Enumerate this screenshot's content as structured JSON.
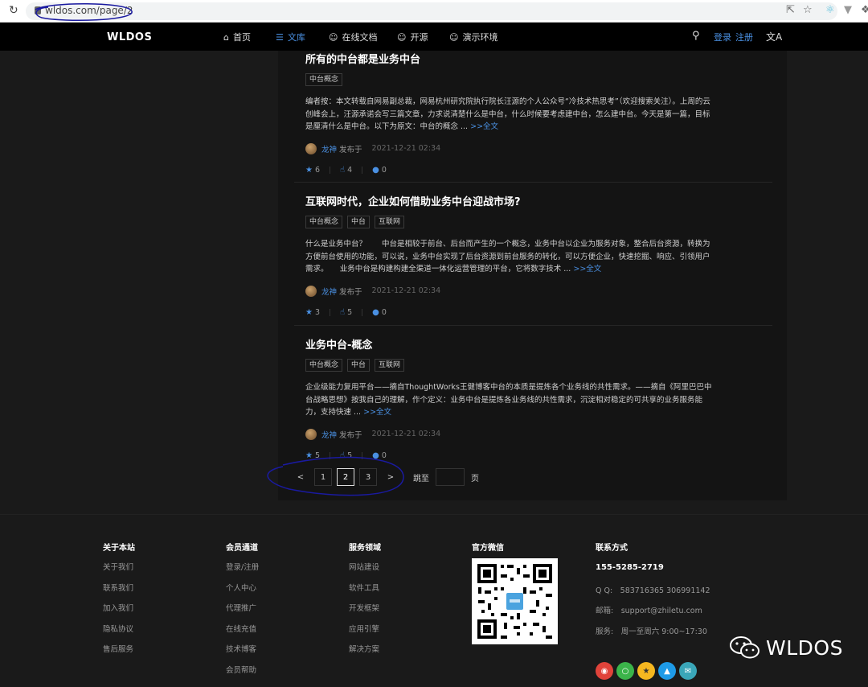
{
  "browser": {
    "url": "wldos.com/page/2",
    "reload_icon": "reload-icon",
    "ext_icons": [
      "share-icon",
      "star-icon",
      "react-icon",
      "vue-icon",
      "puzzle-icon"
    ]
  },
  "nav": {
    "logo": "WLDOS",
    "items": [
      {
        "label": "首页",
        "icon": "home-icon",
        "active": false
      },
      {
        "label": "文库",
        "icon": "list-icon",
        "active": true
      },
      {
        "label": "在线文档",
        "icon": "smile-icon",
        "active": false
      },
      {
        "label": "开源",
        "icon": "smile-icon",
        "active": false
      },
      {
        "label": "演示环境",
        "icon": "smile-icon",
        "active": false
      }
    ],
    "login": "登录",
    "register": "注册"
  },
  "articles": [
    {
      "title": "所有的中台都是业务中台",
      "tags": [
        "中台概念"
      ],
      "excerpt": "编者按：本文转载自网易副总裁，网易杭州研究院执行院长汪源的个人公众号“冷技术热思考”（欢迎搜索关注）。上周的云创峰会上，汪源承诺会写三篇文章，力求说清楚什么是中台，什么时候要考虑建中台，怎么建中台。今天是第一篇，目标是厘清什么是中台。以下为原文：中台的概念 ... ",
      "more": ">>全文",
      "author": "龙神",
      "posted": "发布于",
      "date": "2021-12-21 02:34",
      "stars": "6",
      "likes": "4",
      "comments": "0"
    },
    {
      "title": "互联网时代，企业如何借助业务中台迎战市场?",
      "tags": [
        "中台概念",
        "中台",
        "互联网"
      ],
      "excerpt": "什么是业务中台？　　中台是相较于前台、后台而产生的一个概念，业务中台以企业为服务对象，整合后台资源，转换为方便前台使用的功能，可以说，业务中台实现了后台资源到前台服务的转化，可以方便企业，快速挖掘、响应、引领用户需求。　　业务中台是构建构建全渠道一体化运营管理的平台，它将数字技术 ... ",
      "more": ">>全文",
      "author": "龙神",
      "posted": "发布于",
      "date": "2021-12-21 02:34",
      "stars": "3",
      "likes": "5",
      "comments": "0"
    },
    {
      "title": "业务中台-概念",
      "tags": [
        "中台概念",
        "中台",
        "互联网"
      ],
      "excerpt": "企业级能力复用平台——摘自ThoughtWorks王健博客中台的本质是提炼各个业务线的共性需求。——摘自《阿里巴巴中台战略思想》按我自己的理解，作个定义：业务中台是提炼各业务线的共性需求，沉淀相对稳定的可共享的业务服务能力，支持快速 ... ",
      "more": ">>全文",
      "author": "龙神",
      "posted": "发布于",
      "date": "2021-12-21 02:34",
      "stars": "5",
      "likes": "5",
      "comments": "0"
    }
  ],
  "pagination": {
    "prev": "<",
    "pages": [
      "1",
      "2",
      "3"
    ],
    "current": 2,
    "next": ">",
    "jump_label": "跳至",
    "jump_suffix": "页"
  },
  "footer": {
    "about": {
      "title": "关于本站",
      "links": [
        "关于我们",
        "联系我们",
        "加入我们",
        "隐私协议",
        "售后服务"
      ]
    },
    "member": {
      "title": "会员通道",
      "links": [
        "登录/注册",
        "个人中心",
        "代理推广",
        "在线充值",
        "技术博客",
        "会员帮助"
      ]
    },
    "service": {
      "title": "服务领域",
      "links": [
        "网站建设",
        "软件工具",
        "开发框架",
        "应用引擎",
        "解决方案"
      ]
    },
    "wechat": {
      "title": "官方微信"
    },
    "contact": {
      "title": "联系方式",
      "phone": "155-5285-2719",
      "qq": "Q Q:　583716365 306991142",
      "email": "邮箱:　support@zhiletu.com",
      "hours": "服务:　周一至周六 9:00~17:30"
    },
    "socials": [
      {
        "icon": "weibo-icon",
        "color": "#e0433a"
      },
      {
        "icon": "wechat-icon",
        "color": "#3bb44a"
      },
      {
        "icon": "star-icon",
        "color": "#f5b720"
      },
      {
        "icon": "qq-icon",
        "color": "#1e9be8"
      },
      {
        "icon": "mail-icon",
        "color": "#3aa6b8"
      }
    ]
  },
  "watermark": "WLDOS",
  "colors": {
    "accent": "#4a90e2",
    "bg": "#1a1a1a",
    "panel": "#141414",
    "nav": "#000000"
  }
}
